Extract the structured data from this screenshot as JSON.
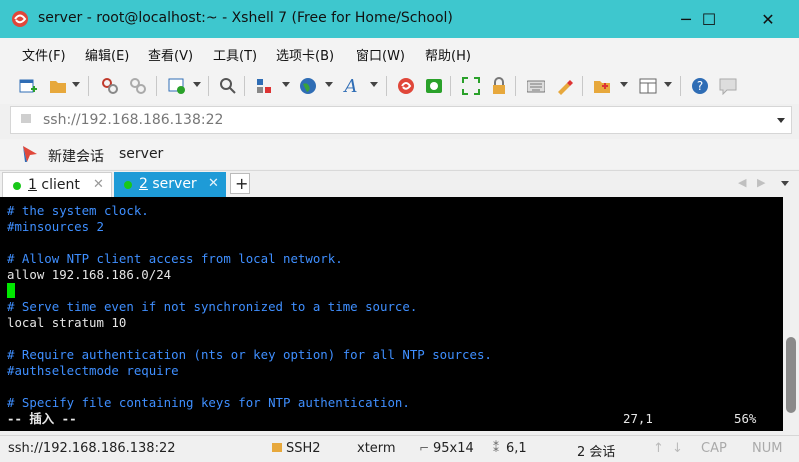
{
  "window": {
    "title": "server - root@localhost:~ - Xshell 7 (Free for Home/School)",
    "minimize_glyph": "─",
    "maximize_glyph": "☐",
    "close_glyph": "✕"
  },
  "menu": {
    "items": [
      {
        "label": "文件(F)"
      },
      {
        "label": "编辑(E)"
      },
      {
        "label": "查看(V)"
      },
      {
        "label": "工具(T)"
      },
      {
        "label": "选项卡(B)"
      },
      {
        "label": "窗口(W)"
      },
      {
        "label": "帮助(H)"
      }
    ]
  },
  "toolbar": {
    "icons": [
      "new-session-icon",
      "open-folder-icon",
      "connect-icon",
      "disconnect-icon",
      "properties-icon",
      "zoom-icon",
      "layout-icon",
      "globe-icon",
      "font-icon",
      "xshell-logo-icon",
      "xftp-icon",
      "fullscreen-icon",
      "lock-icon",
      "keyboard-icon",
      "highlight-pen-icon",
      "new-folder-icon",
      "window-layout-icon",
      "help-icon",
      "chat-icon"
    ]
  },
  "address": {
    "value": "ssh://192.168.186.138:22"
  },
  "links": {
    "new_session": "新建会话",
    "server": "server"
  },
  "tabs": [
    {
      "num": "1",
      "label": "client",
      "active": false
    },
    {
      "num": "2",
      "label": "server",
      "active": true
    }
  ],
  "tab_add": "+",
  "terminal": {
    "lines": [
      {
        "text": "# the system clock.",
        "type": "cmt"
      },
      {
        "text": "#minsources 2",
        "type": "cmt"
      },
      {
        "text": "",
        "type": "txt"
      },
      {
        "text": "# Allow NTP client access from local network.",
        "type": "cmt"
      },
      {
        "text": "allow 192.168.186.0/24",
        "type": "txt"
      },
      {
        "text": "",
        "type": "txt"
      },
      {
        "text": "# Serve time even if not synchronized to a time source.",
        "type": "cmt"
      },
      {
        "text": "local stratum 10",
        "type": "txt"
      },
      {
        "text": "",
        "type": "txt"
      },
      {
        "text": "# Require authentication (nts or key option) for all NTP sources.",
        "type": "cmt"
      },
      {
        "text": "#authselectmode require",
        "type": "cmt"
      },
      {
        "text": "",
        "type": "txt"
      },
      {
        "text": "# Specify file containing keys for NTP authentication.",
        "type": "cmt"
      }
    ],
    "mode_line": "-- 插入 --",
    "position": "27,1",
    "percent": "56%"
  },
  "status": {
    "address": "ssh://192.168.186.138:22",
    "protocol": "SSH2",
    "term": "xterm",
    "size": "95x14",
    "cursor_pos": "6,1",
    "sessions": "2 会话",
    "caps": "CAP",
    "num": "NUM"
  },
  "colors": {
    "titlebar": "#3ec7ce",
    "active_tab": "#1e9bd7",
    "terminal_bg": "#000000",
    "comment": "#3f8fff",
    "cursor": "#00e800"
  }
}
